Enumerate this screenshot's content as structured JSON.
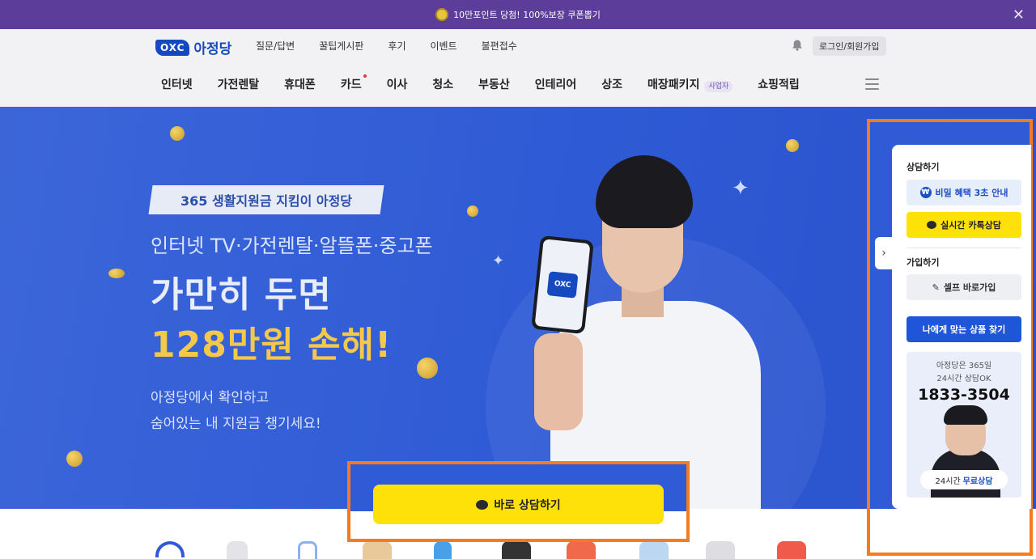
{
  "promo": {
    "text": "10만포인트 당첨! 100%보장 쿠폰뽑기",
    "close": "✕"
  },
  "header": {
    "logo_badge": "OXC",
    "logo_name": "아정당",
    "top_links": [
      "질문/답변",
      "꿀팁게시판",
      "후기",
      "이벤트",
      "불편접수"
    ],
    "login": "로그인/회원가입"
  },
  "nav": {
    "items": [
      "인터넷",
      "가전렌탈",
      "휴대폰",
      "카드",
      "이사",
      "청소",
      "부동산",
      "인테리어",
      "상조",
      "매장패키지",
      "쇼핑적립"
    ],
    "business_tag": "사업자"
  },
  "hero": {
    "ribbon": "365 생활지원금 지킴이 아정당",
    "subtitle": "인터넷 TV·가전렌탈·알뜰폰·중고폰",
    "title": "가만히 두면",
    "loss": "128만원 손해!",
    "desc1": "아정당에서 확인하고",
    "desc2": "숨어있는 내 지원금 챙기세요!",
    "phone_logo": "OXC",
    "cta": "바로 상담하기"
  },
  "side": {
    "toggle": "›",
    "consult_head": "상담하기",
    "secret_btn": "비밀 혜택 3초 안내",
    "won": "₩",
    "kakao_btn": "실시간 카톡상담",
    "join_head": "가입하기",
    "self_btn": "셀프 바로가입",
    "find_btn": "나에게 맞는 상품 찾기",
    "promo_line1": "아정당은 365일",
    "promo_line2": "24시간 상담OK",
    "phone": "1833-3504",
    "pill_pre": "24시간",
    "pill_free": "무료상담"
  },
  "colors": {
    "promo_bg": "#5c3d99",
    "brand_blue": "#1549c2",
    "hero_bg": "#2f5bd6",
    "cta_yellow": "#ffe10a",
    "highlight_orange": "#f47b20",
    "gold_text": "#f4c84a"
  },
  "icons": [
    "coin-icon",
    "close-icon",
    "bell-icon",
    "hamburger-icon",
    "chevron-right-icon",
    "won-icon",
    "chat-bubble-icon",
    "pencil-icon"
  ]
}
